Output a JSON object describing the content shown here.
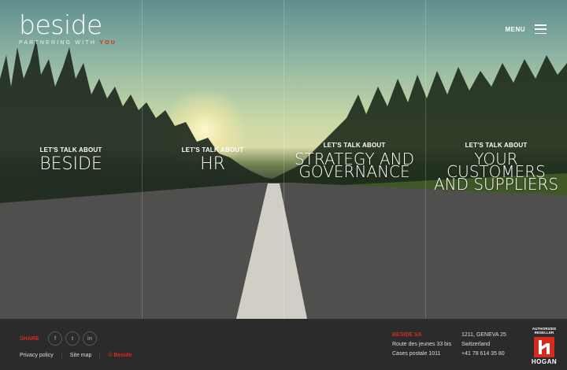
{
  "logo": {
    "word": "beside",
    "tag": "PARTNERING WITH",
    "tag_highlight": "YOU"
  },
  "menu": {
    "label": "MENU"
  },
  "panels": [
    {
      "kicker": "LET'S TALK ABOUT",
      "title": "BESIDE"
    },
    {
      "kicker": "LET'S TALK ABOUT",
      "title": "HR"
    },
    {
      "kicker": "LET'S TALK ABOUT",
      "title_line1": "STRATEGY AND",
      "title_line2": "GOVERNANCE"
    },
    {
      "kicker": "LET'S TALK ABOUT",
      "title_line1": "YOUR CUSTOMERS",
      "title_line2": "AND SUPPLIERS"
    }
  ],
  "footer": {
    "share_label": "SHARE",
    "social": [
      {
        "icon": "facebook-icon",
        "glyph": "f"
      },
      {
        "icon": "twitter-icon",
        "glyph": "t"
      },
      {
        "icon": "linkedin-icon",
        "glyph": "in"
      }
    ],
    "links": [
      "Privacy policy",
      "Site map",
      "© Beside"
    ],
    "address": {
      "company": "BESIDE SA",
      "line1": "Route des jeunes 33 bis",
      "line2": "Cases postale 1011",
      "city": "1211, GENEVA 25",
      "country": "Switzerland",
      "phone": "+41 78 614 35 80"
    },
    "badge": {
      "authorized": "AUTHORIZED RESELLER",
      "name": "HOGAN"
    }
  },
  "colors": {
    "accent": "#d52b1e",
    "footer_bg": "#2b2b2b"
  }
}
